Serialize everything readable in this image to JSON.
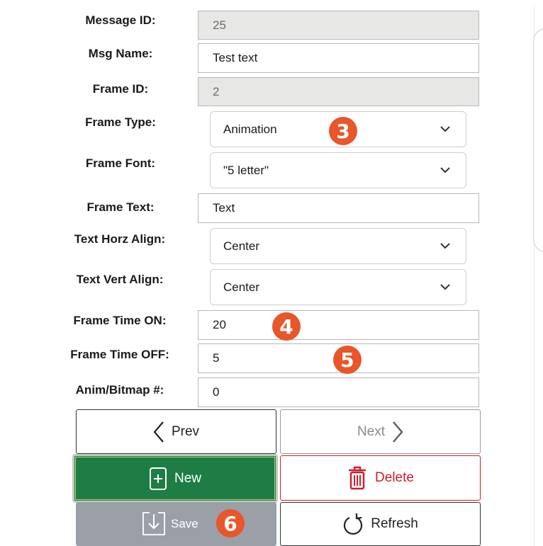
{
  "form": {
    "message_id": {
      "label": "Message ID:",
      "value": "25"
    },
    "msg_name": {
      "label": "Msg Name:",
      "value": "Test text"
    },
    "frame_id": {
      "label": "Frame ID:",
      "value": "2"
    },
    "frame_type": {
      "label": "Frame Type:",
      "value": "Animation"
    },
    "frame_font": {
      "label": "Frame Font:",
      "value": "\"5 letter\""
    },
    "frame_text": {
      "label": "Frame Text:",
      "value": "Text"
    },
    "text_horz_align": {
      "label": "Text Horz Align:",
      "value": "Center"
    },
    "text_vert_align": {
      "label": "Text Vert Align:",
      "value": "Center"
    },
    "frame_time_on": {
      "label": "Frame Time ON:",
      "value": "20"
    },
    "frame_time_off": {
      "label": "Frame Time OFF:",
      "value": "5"
    },
    "anim_bitmap": {
      "label": "Anim/Bitmap #:",
      "value": "0"
    }
  },
  "badges": {
    "b3": "3",
    "b4": "4",
    "b5": "5",
    "b6": "6"
  },
  "buttons": {
    "prev": "Prev",
    "next": "Next",
    "new": "New",
    "delete": "Delete",
    "save": "Save",
    "refresh": "Refresh"
  },
  "colors": {
    "badge": "#e8562a",
    "new_button": "#1e7d45",
    "delete_text": "#c8202f",
    "save_button": "#9aa0a6"
  }
}
